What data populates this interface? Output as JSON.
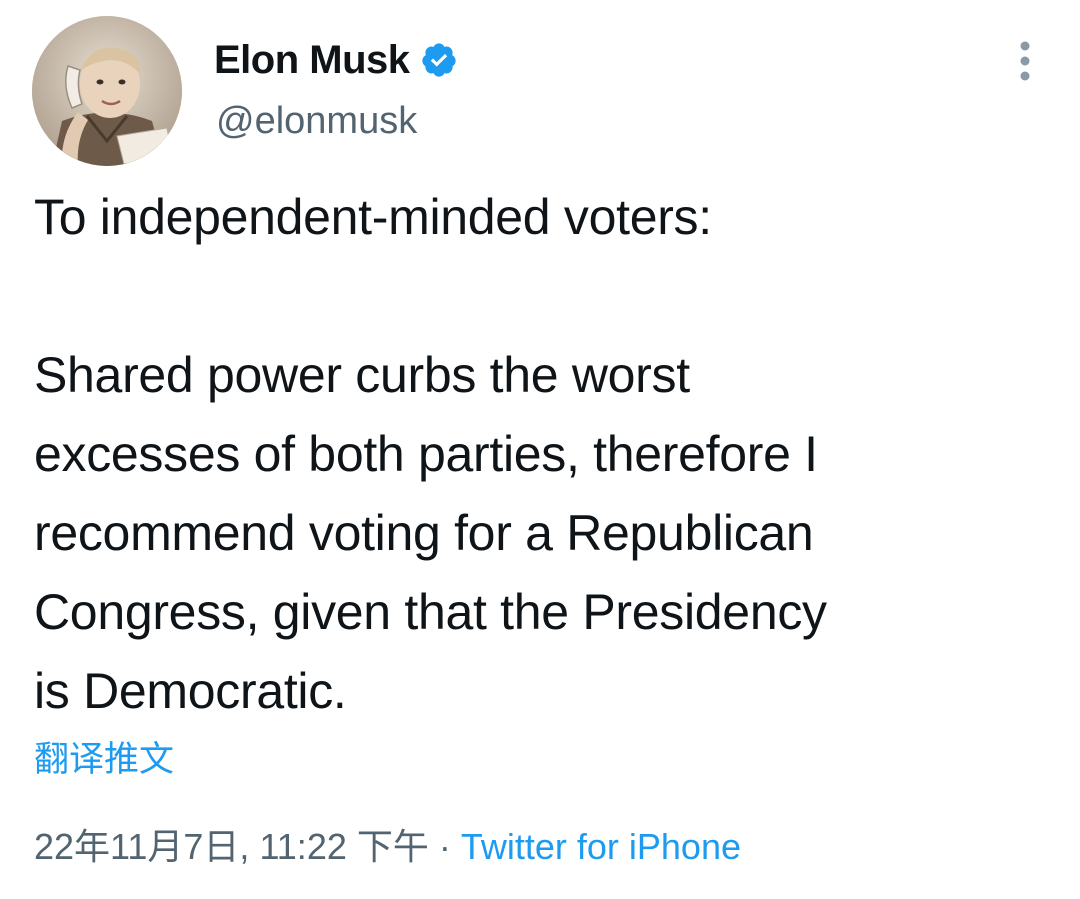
{
  "author": {
    "display_name": "Elon Musk",
    "handle": "@elonmusk",
    "verified": true,
    "avatar_icon": "childhood-photo-avatar"
  },
  "header": {
    "more_icon": "vertical-ellipsis-icon"
  },
  "tweet": {
    "lines": [
      "To independent-minded voters:",
      "",
      "Shared power curbs the worst",
      "excesses of both parties, therefore I",
      "recommend voting for a Republican",
      "Congress, given that the Presidency",
      "is Democratic."
    ],
    "translate_label": "翻译推文",
    "timestamp": "22年11月7日, 11:22 下午",
    "separator": "·",
    "source": "Twitter for iPhone"
  },
  "colors": {
    "text": "#0f1419",
    "secondary": "#536471",
    "accent": "#1d9bf0",
    "background": "#ffffff"
  }
}
